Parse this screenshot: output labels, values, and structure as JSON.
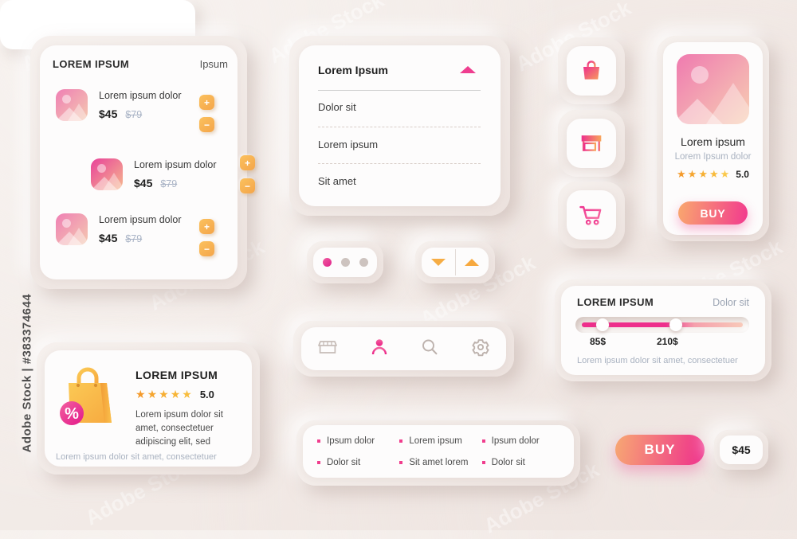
{
  "watermark": {
    "text": "Adobe Stock | #383374644",
    "tile": "Adobe Stock"
  },
  "colors": {
    "background": "#f2eae6",
    "accent_pink": "#ee2f8c",
    "accent_orange": "#f7a93f",
    "card_white": "#fdfcfc",
    "muted_text": "#a9b2c0"
  },
  "cart_card": {
    "title": "LOREM IPSUM",
    "action_label": "Ipsum",
    "rows": [
      {
        "name": "Lorem ipsum dolor",
        "price": "$45",
        "old_price": "$79",
        "plus": "+",
        "minus": "−"
      },
      {
        "name": "Lorem ipsum dolor",
        "price": "$45",
        "old_price": "$79",
        "plus": "+",
        "minus": "−"
      },
      {
        "name": "Lorem ipsum dolor",
        "price": "$45",
        "old_price": "$79",
        "plus": "+",
        "minus": "−"
      }
    ]
  },
  "accordion": {
    "header": "Lorem Ipsum",
    "items": [
      "Dolor sit",
      "Lorem ipsum",
      "Sit amet"
    ]
  },
  "icon_buttons": [
    {
      "name": "shopping-bag-icon",
      "label": "shopping-bag"
    },
    {
      "name": "store-icon",
      "label": "store"
    },
    {
      "name": "shopping-cart-icon",
      "label": "shopping-cart"
    }
  ],
  "product_card": {
    "title": "Lorem ipsum",
    "subtitle": "Lorem Ipsum dolor",
    "rating": "5.0",
    "stars": 5,
    "buy_label": "BUY"
  },
  "pagination": {
    "dots": 3,
    "active_index": 0
  },
  "stepper": {
    "down": "down-arrow",
    "up": "up-arrow"
  },
  "nav_bar": {
    "items": [
      {
        "name": "store-icon",
        "active": false
      },
      {
        "name": "user-icon",
        "active": true
      },
      {
        "name": "search-icon",
        "active": false
      },
      {
        "name": "gear-icon",
        "active": false
      }
    ]
  },
  "slider_card": {
    "title": "LOREM IPSUM",
    "action_label": "Dolor sit",
    "min_value": "85$",
    "max_value": "210$",
    "note": "Lorem ipsum dolor sit amet, consectetuer"
  },
  "promo_card": {
    "title": "LOREM IPSUM",
    "rating": "5.0",
    "stars": 5,
    "badge": "%",
    "description": "Lorem ipsum dolor sit amet, consectetuer adipiscing elit, sed",
    "footer": "Lorem ipsum dolor sit amet, consectetuer"
  },
  "bullet_list": {
    "items": [
      "Ipsum dolor",
      "Lorem ipsum",
      "Ipsum dolor",
      "Dolor sit",
      "Sit amet lorem",
      "Dolor sit"
    ]
  },
  "buy_bar": {
    "buy_label": "BUY",
    "price": "$45"
  }
}
